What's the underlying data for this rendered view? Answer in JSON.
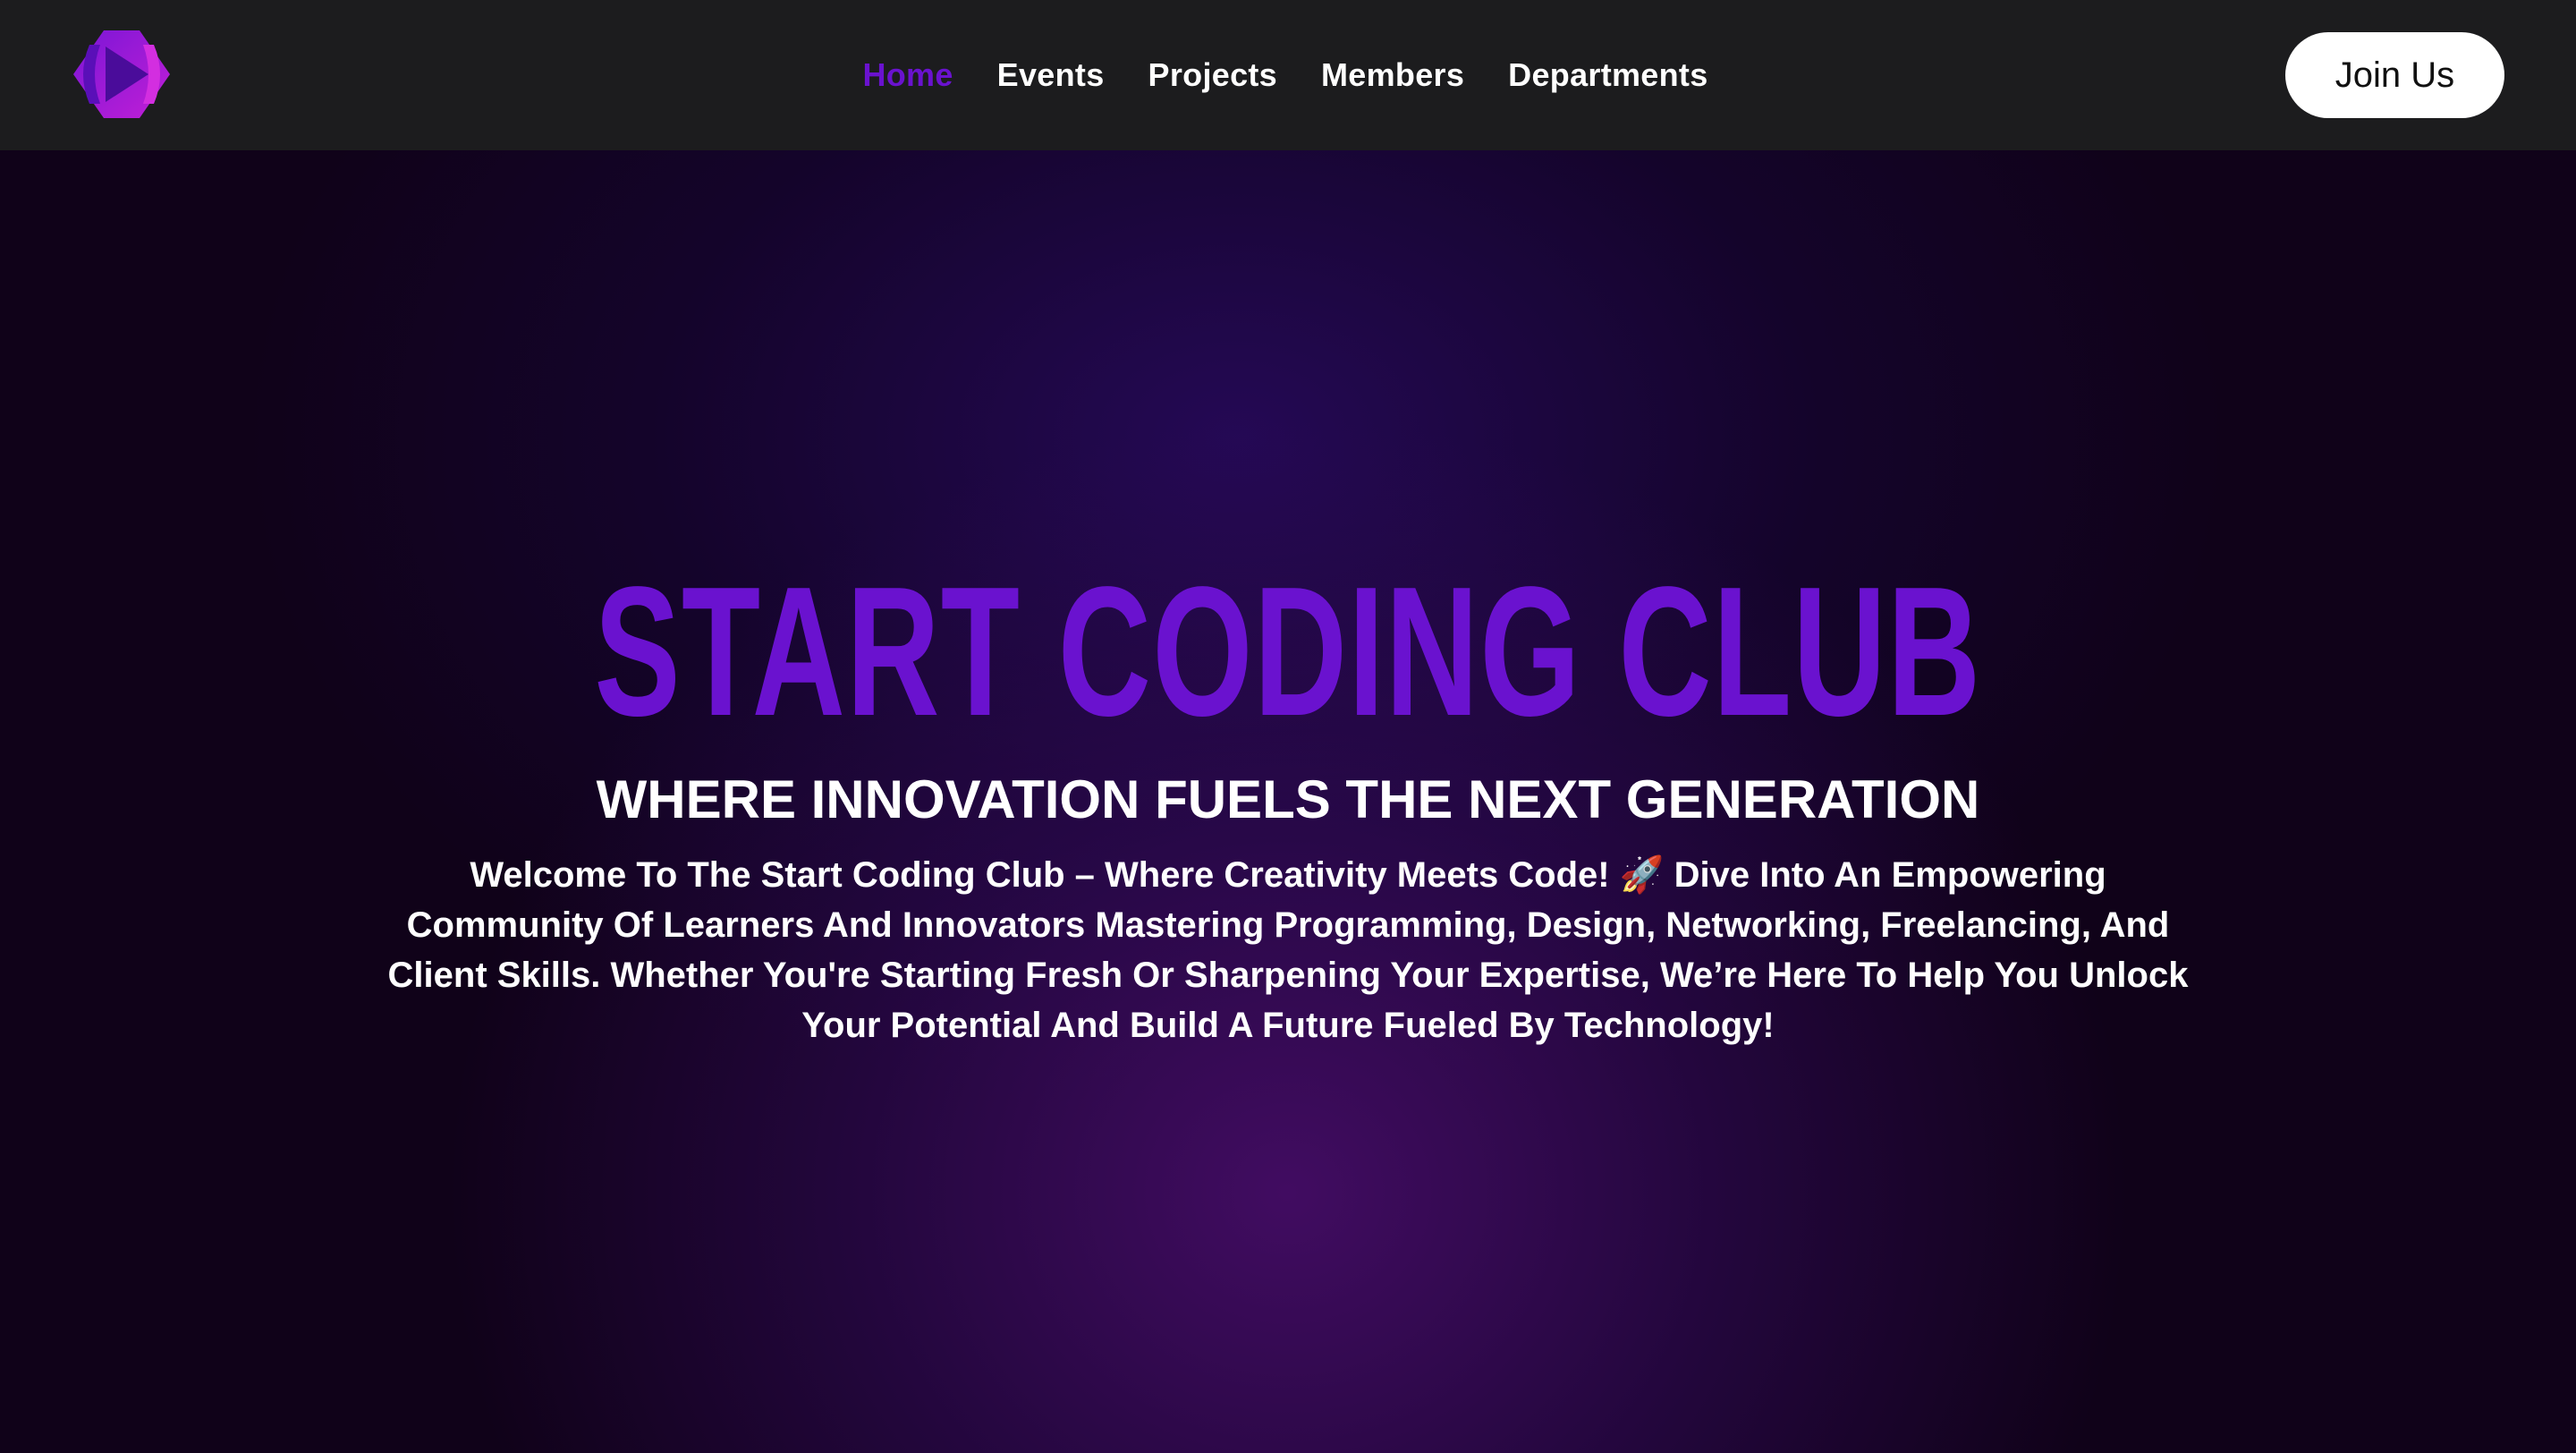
{
  "nav": {
    "logo_icon": "play-hexagon-logo-icon",
    "links": [
      {
        "label": "Home",
        "active": true
      },
      {
        "label": "Events",
        "active": false
      },
      {
        "label": "Projects",
        "active": false
      },
      {
        "label": "Members",
        "active": false
      },
      {
        "label": "Departments",
        "active": false
      }
    ],
    "cta_label": "Join Us"
  },
  "hero": {
    "title": "START CODING CLUB",
    "subtitle": "WHERE INNOVATION FUELS THE NEXT GENERATION",
    "description": "Welcome To The Start Coding Club – Where Creativity Meets Code! 🚀 Dive Into An Empowering Community Of Learners And Innovators Mastering Programming, Design, Networking, Freelancing, And Client Skills. Whether You're Starting Fresh Or Sharpening Your Expertise, We’re Here To Help You Unlock Your Potential And Build A Future Fueled By Technology!"
  },
  "colors": {
    "accent": "#6a12cf",
    "navbar_bg": "#1c1c1e",
    "hero_bg": "#100219",
    "text": "#ffffff"
  }
}
